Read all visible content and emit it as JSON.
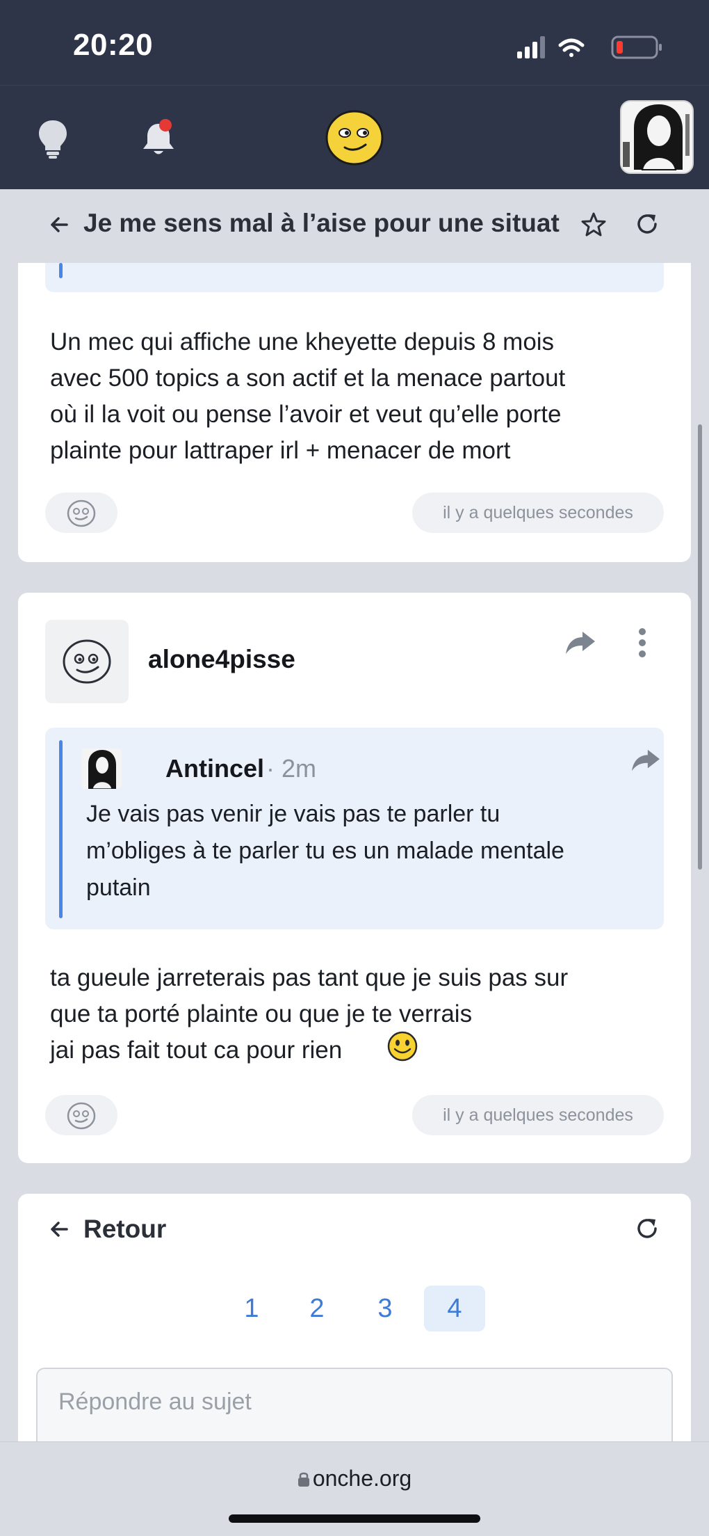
{
  "status_bar": {
    "time": "20:20"
  },
  "topic": {
    "title": "Je me sens mal à l’aise pour une situat"
  },
  "post1": {
    "body": "Un mec qui affiche une kheyette depuis 8 mois\navec 500 topics a son actif et la menace partout\noù il la voit ou pense l’avoir et veut qu’elle porte\nplainte pour lattraper irl + menacer de mort",
    "timestamp": "il y a quelques secondes"
  },
  "post2": {
    "username": "alone4pisse",
    "quote": {
      "author": "Antincel",
      "separator": "·",
      "age": "2m",
      "text": "Je vais pas venir je vais pas te parler tu\nm’obliges à te parler tu es un malade mentale\nputain"
    },
    "body": "ta gueule jarreterais pas tant que je suis pas sur\nque ta porté plainte ou que je te verrais\njai pas fait tout ca pour rien",
    "timestamp": "il y a quelques secondes"
  },
  "footer_nav": {
    "back_label": "Retour",
    "pages": [
      "1",
      "2",
      "3",
      "4"
    ],
    "current_page": "4",
    "reply_placeholder": "Répondre au sujet"
  },
  "browser": {
    "url": "onche.org"
  },
  "colors": {
    "header_bg": "#2f3548",
    "accent": "#3e7bd6",
    "quote_bar": "#4a86e8",
    "notification": "#e53935"
  },
  "icons": [
    "lightbulb-icon",
    "bell-icon",
    "smiley-logo-icon",
    "arrow-left-icon",
    "star-icon",
    "refresh-icon",
    "share-icon",
    "more-vertical-icon",
    "lock-icon"
  ]
}
